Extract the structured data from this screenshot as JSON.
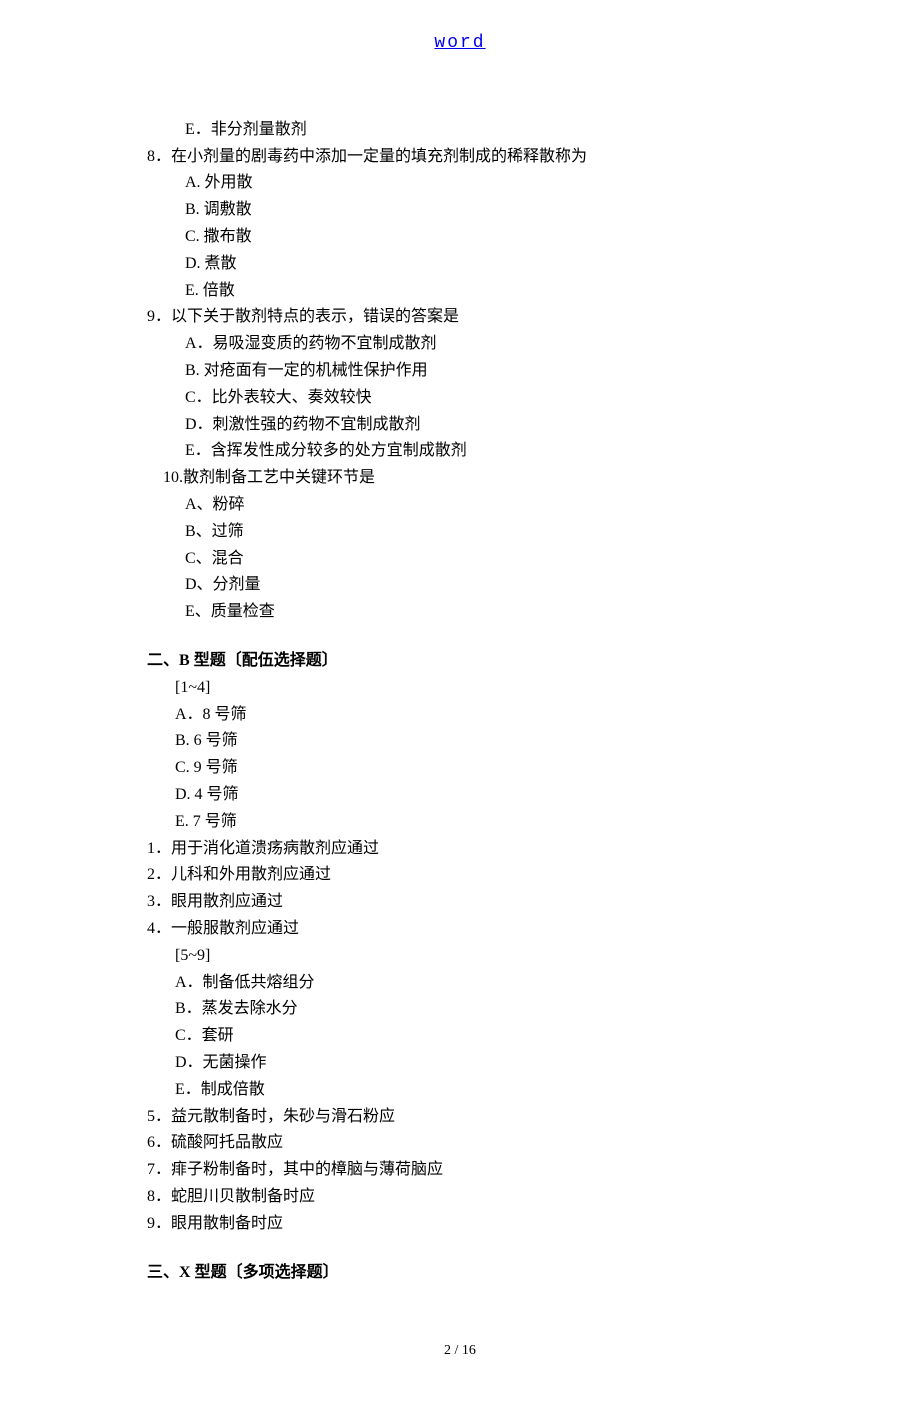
{
  "header": {
    "link_text": "word"
  },
  "q7_tail": {
    "E": "E．非分剂量散剂"
  },
  "q8": {
    "stem": "8．在小剂量的剧毒药中添加一定量的填充剂制成的稀释散称为",
    "A": "A. 外用散",
    "B": "B. 调敷散",
    "C": "C. 撒布散",
    "D": "D. 煮散",
    "E": "E. 倍散"
  },
  "q9": {
    "stem": "9．以下关于散剂特点的表示，错误的答案是",
    "A": "A．易吸湿变质的药物不宜制成散剂",
    "B": "B. 对疮面有一定的机械性保护作用",
    "C": "C．比外表较大、奏效较快",
    "D": "D．刺激性强的药物不宜制成散剂",
    "E": "E．含挥发性成分较多的处方宜制成散剂"
  },
  "q10": {
    "stem": "10.散剂制备工艺中关键环节是",
    "A": "A、粉碎",
    "B": "B、过筛",
    "C": "C、混合",
    "D": "D、分剂量",
    "E": "E、质量检查"
  },
  "secB": {
    "title_prefix": "二、",
    "title_bold": "B 型题〔配伍选择题〕",
    "range1": "[1~4]",
    "opts1": {
      "A": "A．8 号筛",
      "B": "B. 6 号筛",
      "C": "C. 9 号筛",
      "D": "D. 4 号筛",
      "E": "E. 7 号筛"
    },
    "q1": "1．用于消化道溃疡病散剂应通过",
    "q2": "2．儿科和外用散剂应通过",
    "q3": "3．眼用散剂应通过",
    "q4": "4．一般服散剂应通过",
    "range2": "[5~9]",
    "opts2": {
      "A": "A．制备低共熔组分",
      "B": "B．蒸发去除水分",
      "C": "C．套研",
      "D": "D．无菌操作",
      "E": "E．制成倍散"
    },
    "q5": "5．益元散制备时，朱砂与滑石粉应",
    "q6": "6．硫酸阿托品散应",
    "q7": "7．痱子粉制备时，其中的樟脑与薄荷脑应",
    "q8": "8．蛇胆川贝散制备时应",
    "q9": "9．眼用散制备时应"
  },
  "secX": {
    "title_prefix": "三、",
    "title_bold": "X 型题〔多项选择题〕"
  },
  "footer": {
    "page": "2 / 16"
  }
}
